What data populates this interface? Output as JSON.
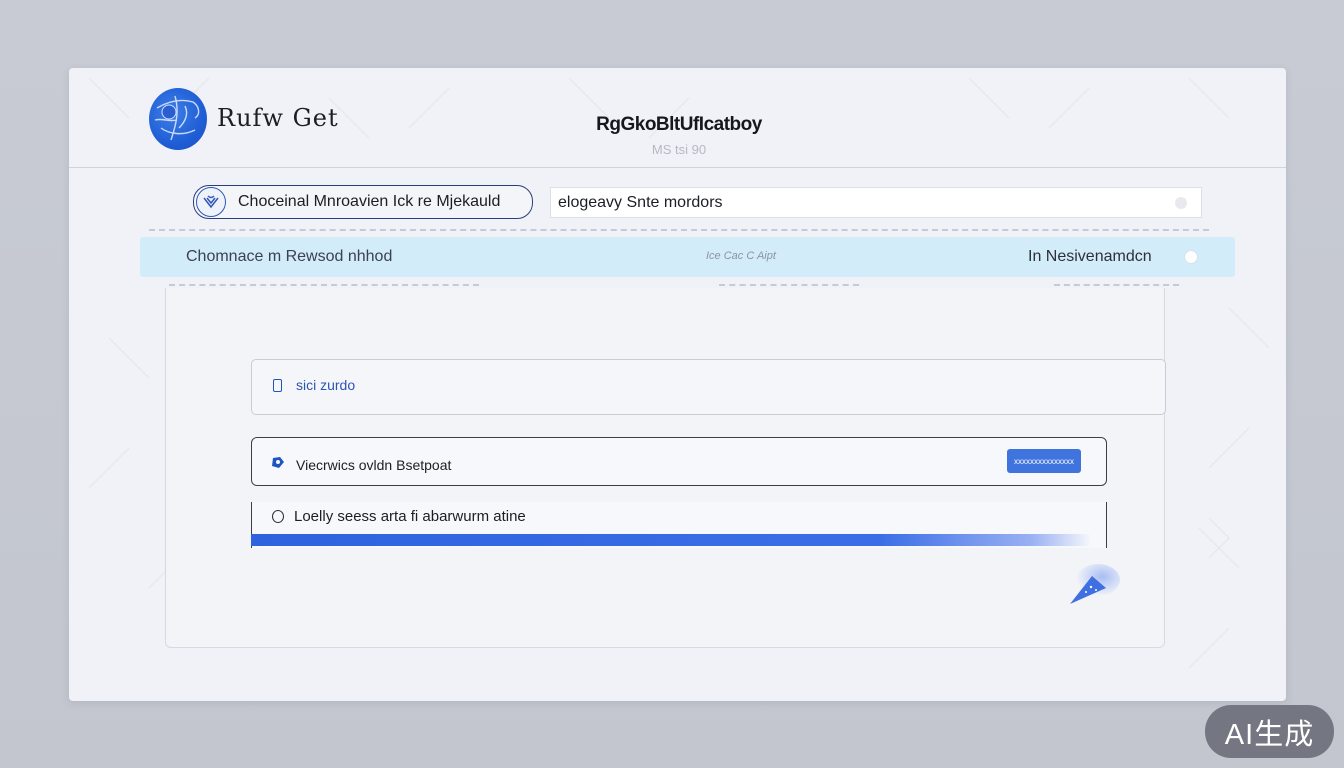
{
  "header": {
    "app_name": "Rufw Get",
    "title": "RgGkoBltUfIcatboy",
    "subtitle": "MS tsi 90"
  },
  "toolbar": {
    "pill_label": "Choceinal Mnroavien Ick re Mjekauld",
    "search_value": "elogeavy Snte mordors"
  },
  "banner": {
    "left_text": "Chomnace m Rewsod nhhod",
    "mid_text": "Ice Cac C Aipt",
    "right_text": "In Nesivenamdcn"
  },
  "rows": {
    "row1_label": "sici zurdo",
    "row2_label": "Viecrwics ovldn Bsetpoat",
    "row2_button": "xxxxxxxxxxxxxxx",
    "row3_label": "Loelly seess arta fi abarwurm atine",
    "progress": 0.94
  },
  "watermark": "AI生成",
  "colors": {
    "accent": "#3f74de",
    "banner": "#d3ecfa",
    "window": "#f1f2f7",
    "background": "#c6c9d2"
  },
  "icons": {
    "logo": "globe-logo-icon",
    "pill": "gift-icon",
    "row1": "doc-icon",
    "row2": "puzzle-icon",
    "row3": "circle-icon",
    "fab": "send-icon"
  }
}
